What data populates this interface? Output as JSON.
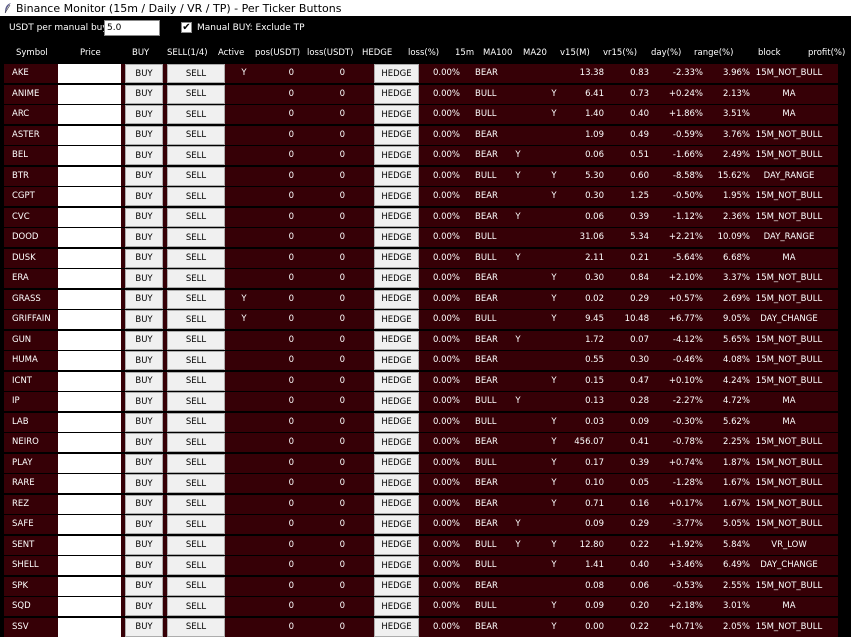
{
  "window": {
    "title": "Binance Monitor (15m / Daily / VR / TP) - Per Ticker Buttons"
  },
  "toolbar": {
    "usdt_label": "USDT per manual buy:",
    "usdt_value": "5.0",
    "manual_buy_checked": true,
    "manual_buy_label": "Manual BUY: Exclude TP"
  },
  "columns": {
    "symbol": "Symbol",
    "price": "Price",
    "buy": "BUY",
    "sell": "SELL(1/4)",
    "active": "Active",
    "pos": "pos(USDT)",
    "loss": "loss(USDT)",
    "hedge": "HEDGE",
    "loss_pct": "loss(%)",
    "m15": "15m",
    "ma100": "MA100",
    "ma20": "MA20",
    "v15": "v15(M)",
    "vr15": "vr15(%)",
    "day": "day(%)",
    "range": "range(%)",
    "block": "block",
    "profit": "profit(%)"
  },
  "buttons": {
    "buy": "BUY",
    "sell": "SELL",
    "hedge": "HEDGE"
  },
  "rows": [
    {
      "symbol": "AKE",
      "active": "Y",
      "pos": "0",
      "loss": "0",
      "loss_pct": "0.00%",
      "m15": "BEAR",
      "ma100": "",
      "ma20": "",
      "v15": "13.38",
      "vr15": "0.83",
      "day": "-2.33%",
      "range": "3.96%",
      "block": "15M_NOT_BULL",
      "profit": ""
    },
    {
      "symbol": "ANIME",
      "active": "",
      "pos": "0",
      "loss": "0",
      "loss_pct": "0.00%",
      "m15": "BULL",
      "ma100": "",
      "ma20": "Y",
      "v15": "6.41",
      "vr15": "0.73",
      "day": "+0.24%",
      "range": "2.13%",
      "block": "MA",
      "profit": ""
    },
    {
      "symbol": "ARC",
      "active": "",
      "pos": "0",
      "loss": "0",
      "loss_pct": "0.00%",
      "m15": "BULL",
      "ma100": "",
      "ma20": "Y",
      "v15": "1.40",
      "vr15": "0.40",
      "day": "+1.86%",
      "range": "3.51%",
      "block": "MA",
      "profit": ""
    },
    {
      "symbol": "ASTER",
      "active": "",
      "pos": "0",
      "loss": "0",
      "loss_pct": "0.00%",
      "m15": "BEAR",
      "ma100": "",
      "ma20": "",
      "v15": "1.09",
      "vr15": "0.49",
      "day": "-0.59%",
      "range": "3.76%",
      "block": "15M_NOT_BULL",
      "profit": ""
    },
    {
      "symbol": "BEL",
      "active": "",
      "pos": "0",
      "loss": "0",
      "loss_pct": "0.00%",
      "m15": "BEAR",
      "ma100": "Y",
      "ma20": "",
      "v15": "0.06",
      "vr15": "0.51",
      "day": "-1.66%",
      "range": "2.49%",
      "block": "15M_NOT_BULL",
      "profit": ""
    },
    {
      "symbol": "BTR",
      "active": "",
      "pos": "0",
      "loss": "0",
      "loss_pct": "0.00%",
      "m15": "BULL",
      "ma100": "Y",
      "ma20": "Y",
      "v15": "5.30",
      "vr15": "0.60",
      "day": "-8.58%",
      "range": "15.62%",
      "block": "DAY_RANGE",
      "profit": ""
    },
    {
      "symbol": "CGPT",
      "active": "",
      "pos": "0",
      "loss": "0",
      "loss_pct": "0.00%",
      "m15": "BEAR",
      "ma100": "",
      "ma20": "Y",
      "v15": "0.30",
      "vr15": "1.25",
      "day": "-0.50%",
      "range": "1.95%",
      "block": "15M_NOT_BULL",
      "profit": ""
    },
    {
      "symbol": "CVC",
      "active": "",
      "pos": "0",
      "loss": "0",
      "loss_pct": "0.00%",
      "m15": "BEAR",
      "ma100": "Y",
      "ma20": "",
      "v15": "0.06",
      "vr15": "0.39",
      "day": "-1.12%",
      "range": "2.36%",
      "block": "15M_NOT_BULL",
      "profit": ""
    },
    {
      "symbol": "DOOD",
      "active": "",
      "pos": "0",
      "loss": "0",
      "loss_pct": "0.00%",
      "m15": "BULL",
      "ma100": "",
      "ma20": "",
      "v15": "31.06",
      "vr15": "5.34",
      "day": "+2.21%",
      "range": "10.09%",
      "block": "DAY_RANGE",
      "profit": ""
    },
    {
      "symbol": "DUSK",
      "active": "",
      "pos": "0",
      "loss": "0",
      "loss_pct": "0.00%",
      "m15": "BULL",
      "ma100": "Y",
      "ma20": "",
      "v15": "2.11",
      "vr15": "0.21",
      "day": "-5.64%",
      "range": "6.68%",
      "block": "MA",
      "profit": ""
    },
    {
      "symbol": "ERA",
      "active": "",
      "pos": "0",
      "loss": "0",
      "loss_pct": "0.00%",
      "m15": "BEAR",
      "ma100": "",
      "ma20": "Y",
      "v15": "0.30",
      "vr15": "0.84",
      "day": "+2.10%",
      "range": "3.37%",
      "block": "15M_NOT_BULL",
      "profit": ""
    },
    {
      "symbol": "GRASS",
      "active": "Y",
      "pos": "0",
      "loss": "0",
      "loss_pct": "0.00%",
      "m15": "BEAR",
      "ma100": "",
      "ma20": "Y",
      "v15": "0.02",
      "vr15": "0.29",
      "day": "+0.57%",
      "range": "2.69%",
      "block": "15M_NOT_BULL",
      "profit": ""
    },
    {
      "symbol": "GRIFFAIN",
      "active": "Y",
      "pos": "0",
      "loss": "0",
      "loss_pct": "0.00%",
      "m15": "BULL",
      "ma100": "",
      "ma20": "Y",
      "v15": "9.45",
      "vr15": "10.48",
      "day": "+6.77%",
      "range": "9.05%",
      "block": "DAY_CHANGE",
      "profit": ""
    },
    {
      "symbol": "GUN",
      "active": "",
      "pos": "0",
      "loss": "0",
      "loss_pct": "0.00%",
      "m15": "BEAR",
      "ma100": "Y",
      "ma20": "",
      "v15": "1.72",
      "vr15": "0.07",
      "day": "-4.12%",
      "range": "5.65%",
      "block": "15M_NOT_BULL",
      "profit": ""
    },
    {
      "symbol": "HUMA",
      "active": "",
      "pos": "0",
      "loss": "0",
      "loss_pct": "0.00%",
      "m15": "BEAR",
      "ma100": "",
      "ma20": "",
      "v15": "0.55",
      "vr15": "0.30",
      "day": "-0.46%",
      "range": "4.08%",
      "block": "15M_NOT_BULL",
      "profit": ""
    },
    {
      "symbol": "ICNT",
      "active": "",
      "pos": "0",
      "loss": "0",
      "loss_pct": "0.00%",
      "m15": "BEAR",
      "ma100": "",
      "ma20": "Y",
      "v15": "0.15",
      "vr15": "0.47",
      "day": "+0.10%",
      "range": "4.24%",
      "block": "15M_NOT_BULL",
      "profit": ""
    },
    {
      "symbol": "IP",
      "active": "",
      "pos": "0",
      "loss": "0",
      "loss_pct": "0.00%",
      "m15": "BULL",
      "ma100": "Y",
      "ma20": "",
      "v15": "0.13",
      "vr15": "0.28",
      "day": "-2.27%",
      "range": "4.72%",
      "block": "MA",
      "profit": ""
    },
    {
      "symbol": "LAB",
      "active": "",
      "pos": "0",
      "loss": "0",
      "loss_pct": "0.00%",
      "m15": "BULL",
      "ma100": "",
      "ma20": "Y",
      "v15": "0.03",
      "vr15": "0.09",
      "day": "-0.30%",
      "range": "5.62%",
      "block": "MA",
      "profit": ""
    },
    {
      "symbol": "NEIRO",
      "active": "",
      "pos": "0",
      "loss": "0",
      "loss_pct": "0.00%",
      "m15": "BEAR",
      "ma100": "",
      "ma20": "Y",
      "v15": "456.07",
      "vr15": "0.41",
      "day": "-0.78%",
      "range": "2.25%",
      "block": "15M_NOT_BULL",
      "profit": ""
    },
    {
      "symbol": "PLAY",
      "active": "",
      "pos": "0",
      "loss": "0",
      "loss_pct": "0.00%",
      "m15": "BULL",
      "ma100": "",
      "ma20": "Y",
      "v15": "0.17",
      "vr15": "0.39",
      "day": "+0.74%",
      "range": "1.87%",
      "block": "15M_NOT_BULL",
      "profit": ""
    },
    {
      "symbol": "RARE",
      "active": "",
      "pos": "0",
      "loss": "0",
      "loss_pct": "0.00%",
      "m15": "BEAR",
      "ma100": "",
      "ma20": "Y",
      "v15": "0.10",
      "vr15": "0.05",
      "day": "-1.28%",
      "range": "1.67%",
      "block": "15M_NOT_BULL",
      "profit": ""
    },
    {
      "symbol": "REZ",
      "active": "",
      "pos": "0",
      "loss": "0",
      "loss_pct": "0.00%",
      "m15": "BEAR",
      "ma100": "",
      "ma20": "Y",
      "v15": "0.71",
      "vr15": "0.16",
      "day": "+0.17%",
      "range": "1.67%",
      "block": "15M_NOT_BULL",
      "profit": ""
    },
    {
      "symbol": "SAFE",
      "active": "",
      "pos": "0",
      "loss": "0",
      "loss_pct": "0.00%",
      "m15": "BEAR",
      "ma100": "Y",
      "ma20": "",
      "v15": "0.09",
      "vr15": "0.29",
      "day": "-3.77%",
      "range": "5.05%",
      "block": "15M_NOT_BULL",
      "profit": ""
    },
    {
      "symbol": "SENT",
      "active": "",
      "pos": "0",
      "loss": "0",
      "loss_pct": "0.00%",
      "m15": "BULL",
      "ma100": "Y",
      "ma20": "Y",
      "v15": "12.80",
      "vr15": "0.22",
      "day": "+1.92%",
      "range": "5.84%",
      "block": "VR_LOW",
      "profit": ""
    },
    {
      "symbol": "SHELL",
      "active": "",
      "pos": "0",
      "loss": "0",
      "loss_pct": "0.00%",
      "m15": "BULL",
      "ma100": "",
      "ma20": "Y",
      "v15": "1.41",
      "vr15": "0.40",
      "day": "+3.46%",
      "range": "6.49%",
      "block": "DAY_CHANGE",
      "profit": ""
    },
    {
      "symbol": "SPK",
      "active": "",
      "pos": "0",
      "loss": "0",
      "loss_pct": "0.00%",
      "m15": "BEAR",
      "ma100": "",
      "ma20": "",
      "v15": "0.08",
      "vr15": "0.06",
      "day": "-0.53%",
      "range": "2.55%",
      "block": "15M_NOT_BULL",
      "profit": ""
    },
    {
      "symbol": "SQD",
      "active": "",
      "pos": "0",
      "loss": "0",
      "loss_pct": "0.00%",
      "m15": "BULL",
      "ma100": "",
      "ma20": "Y",
      "v15": "0.09",
      "vr15": "0.20",
      "day": "+2.18%",
      "range": "3.01%",
      "block": "MA",
      "profit": ""
    },
    {
      "symbol": "SSV",
      "active": "",
      "pos": "0",
      "loss": "0",
      "loss_pct": "0.00%",
      "m15": "BEAR",
      "ma100": "",
      "ma20": "Y",
      "v15": "0.00",
      "vr15": "0.22",
      "day": "+0.71%",
      "range": "2.05%",
      "block": "15M_NOT_BULL",
      "profit": ""
    }
  ]
}
